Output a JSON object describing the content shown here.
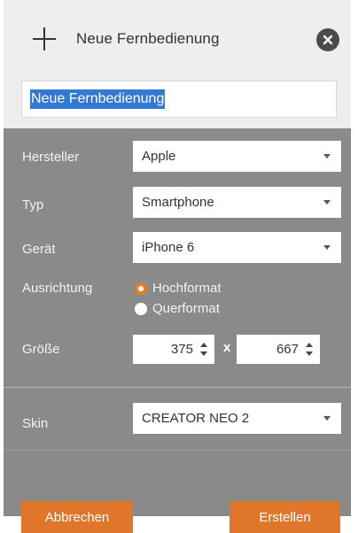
{
  "header": {
    "title": "Neue Fernbedienung",
    "add_icon": "plus-icon",
    "close_icon": "close-circle-icon"
  },
  "name_field": {
    "value": "Neue Fernbedienung"
  },
  "form": {
    "manufacturer": {
      "label": "Hersteller",
      "value": "Apple"
    },
    "type": {
      "label": "Typ",
      "value": "Smartphone"
    },
    "device": {
      "label": "Gerät",
      "value": "iPhone 6"
    },
    "orientation": {
      "label": "Ausrichtung",
      "options": [
        {
          "label": "Hochformat",
          "selected": true
        },
        {
          "label": "Querformat",
          "selected": false
        }
      ]
    },
    "size": {
      "label": "Größe",
      "width": "375",
      "separator": "x",
      "height": "667"
    },
    "skin": {
      "label": "Skin",
      "value": "CREATOR NEO 2"
    }
  },
  "buttons": {
    "cancel": "Abbrechen",
    "create": "Erstellen"
  },
  "colors": {
    "accent": "#e0762a",
    "panel": "#8a8a8a",
    "header_bg": "#eeeeee",
    "selection": "#3478d6"
  }
}
